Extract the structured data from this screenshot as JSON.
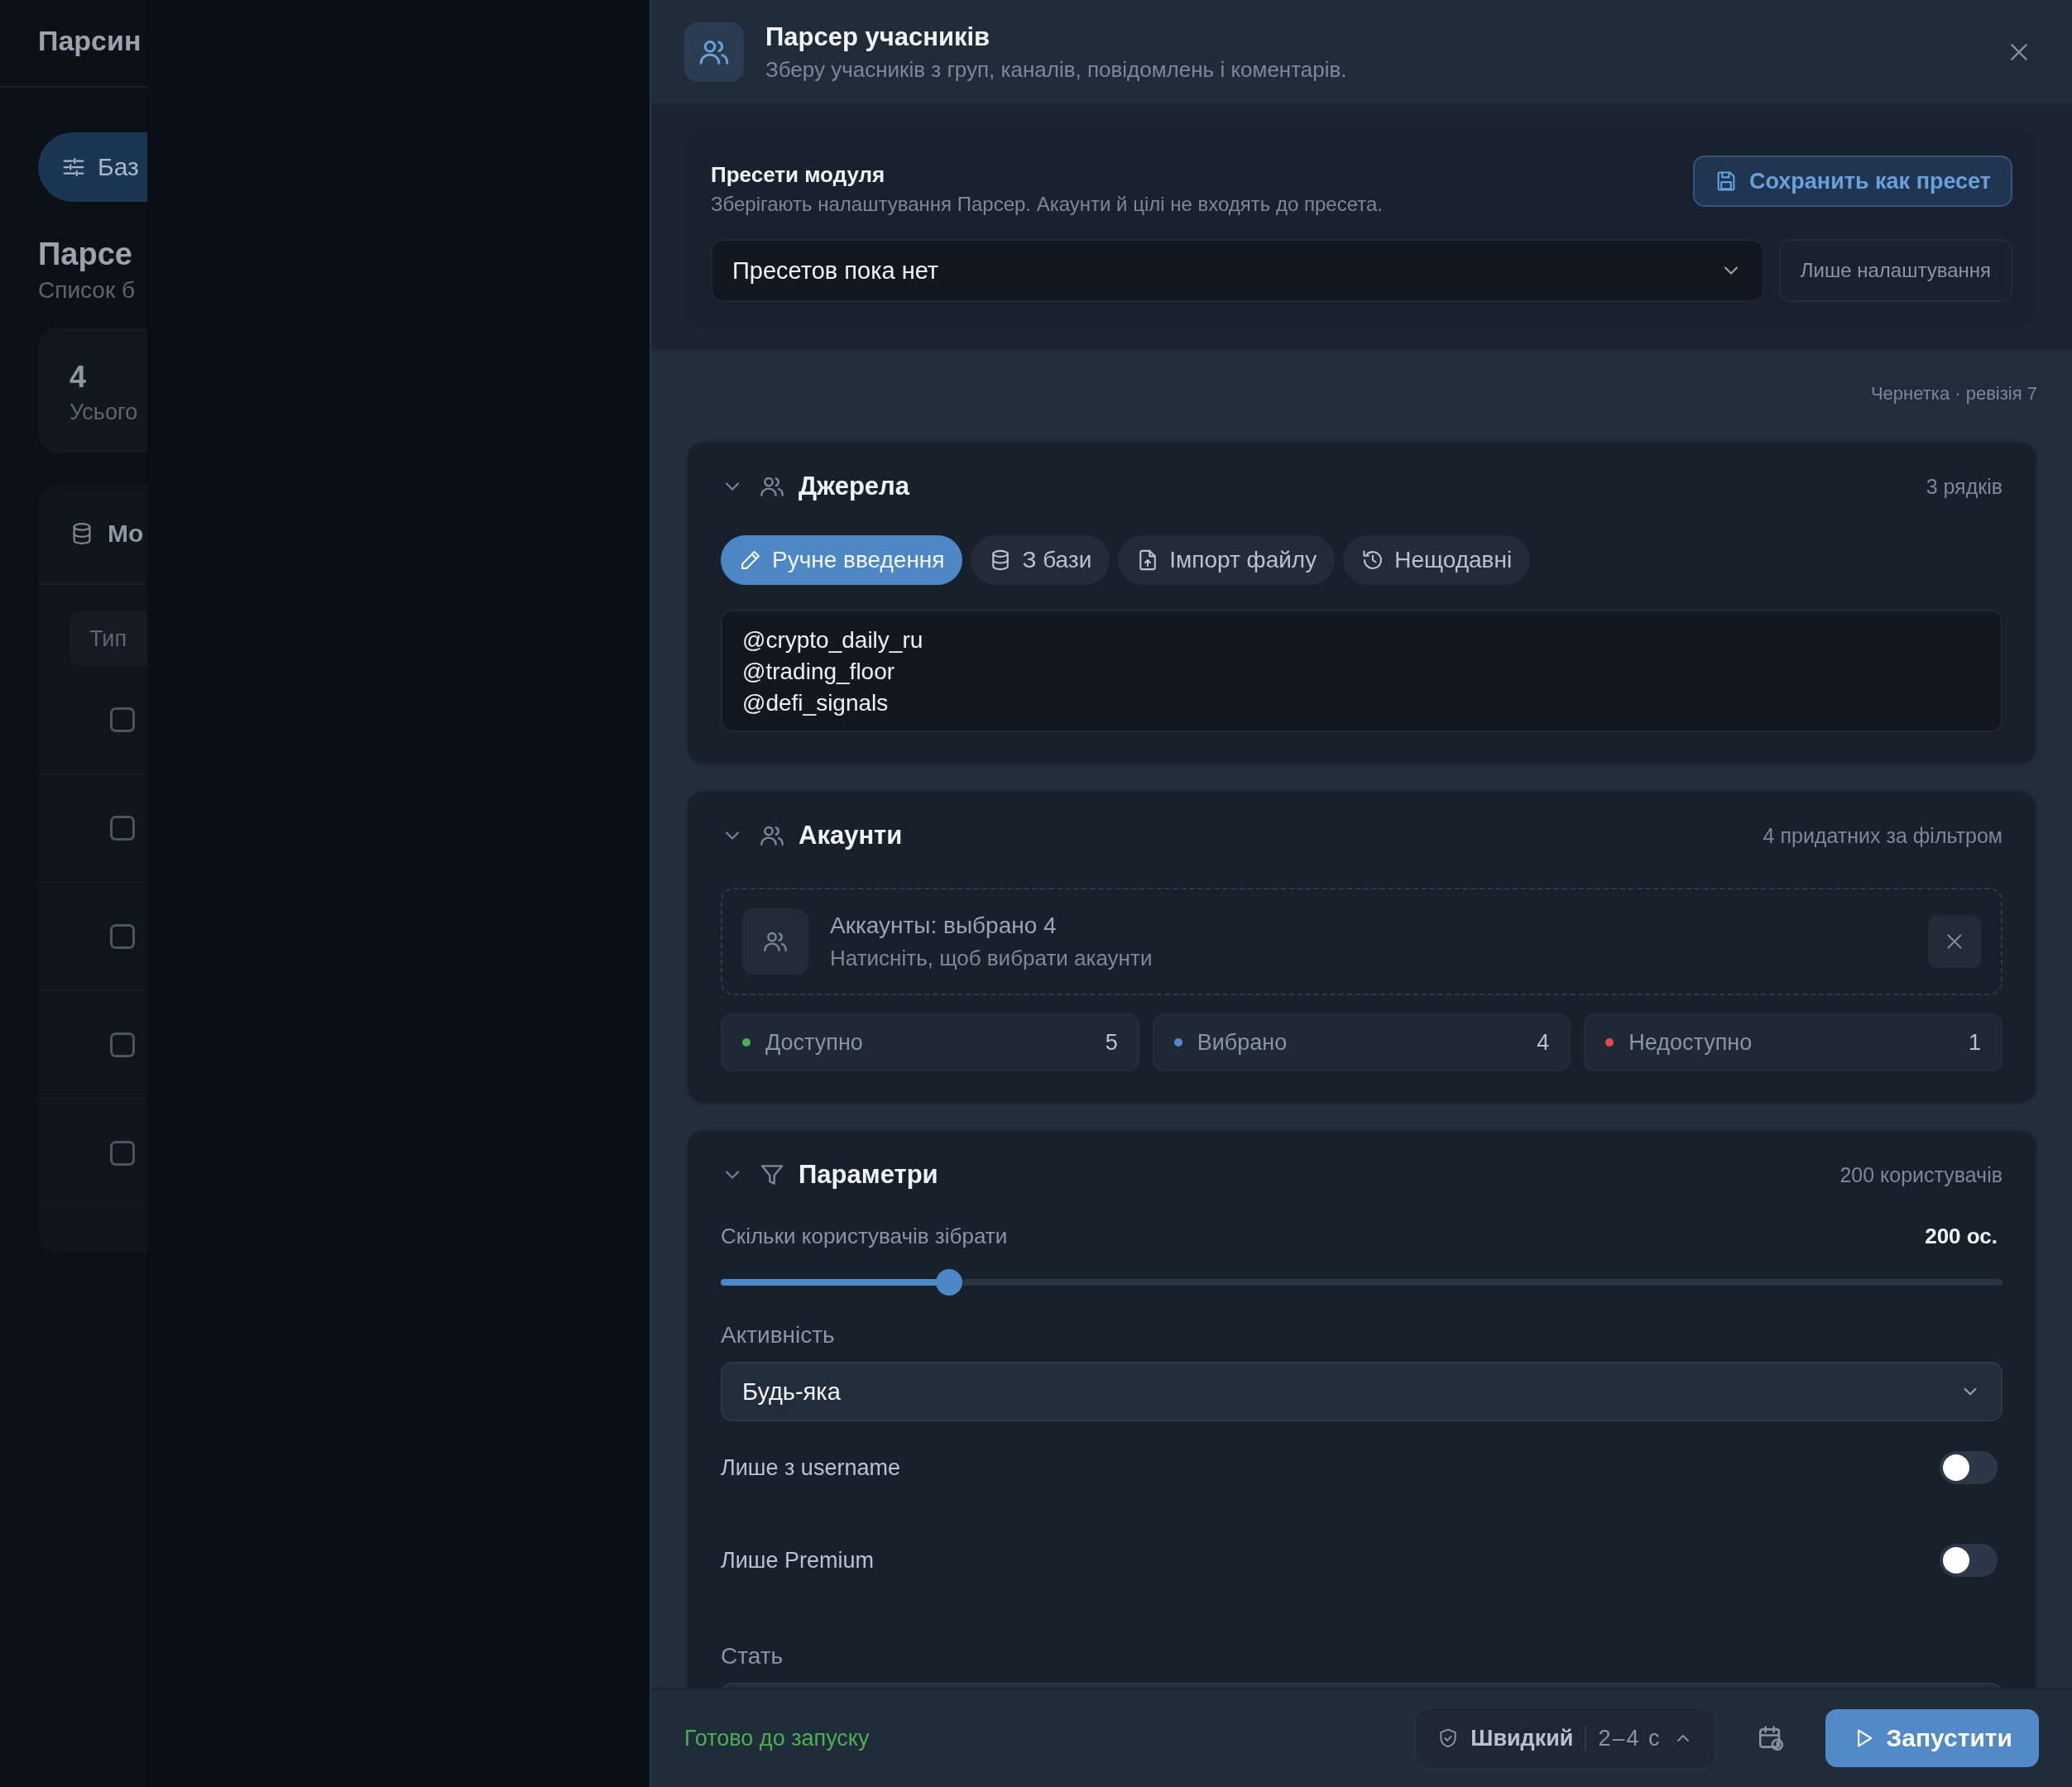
{
  "background": {
    "title": "Парсин",
    "filter_button": "Баз",
    "heading": "Парсе",
    "subheading": "Список б",
    "stat": {
      "value": "4",
      "label": "Усього"
    },
    "panel": {
      "title": "Мо",
      "filter": {
        "placeholder": "Тип"
      },
      "rows": [
        {
          "checked": false
        },
        {
          "checked": false
        },
        {
          "checked": false
        },
        {
          "checked": false
        },
        {
          "checked": false
        }
      ]
    }
  },
  "drawer": {
    "title": "Парсер учасників",
    "subtitle": "Зберу учасників з груп, каналів, повідомлень і коментарів.",
    "presets": {
      "title": "Пресети модуля",
      "description": "Зберігають налаштування Парсер. Акаунти й цілі не входять до пресета.",
      "save_button": "Сохранить как пресет",
      "select": "Пресетов пока нет",
      "settings_only_button": "Лише налаштування"
    },
    "draft_status": "Чернетка · ревізія 7",
    "sources": {
      "title": "Джерела",
      "expanded": true,
      "count": "3 рядків",
      "tabs": [
        {
          "label": "Ручне введення",
          "kind": "pencil",
          "selected": true
        },
        {
          "label": "З бази",
          "kind": "database",
          "selected": false
        },
        {
          "label": "Імпорт файлу",
          "kind": "file",
          "selected": false
        },
        {
          "label": "Нещодавні",
          "kind": "history",
          "selected": false
        }
      ],
      "text": [
        "@crypto_daily_ru",
        "@trading_floor",
        "@defi_signals"
      ]
    },
    "accounts": {
      "title": "Акаунти",
      "expanded": true,
      "count": "4 придатних за фільтром",
      "picker_title": "Аккаунты: выбрано 4",
      "picker_hint": "Натисніть, щоб вибрати акаунти",
      "stats": [
        {
          "label": "Доступно",
          "value": "5",
          "color": "#4caf50"
        },
        {
          "label": "Вибрано",
          "value": "4",
          "color": "#4d8ad0"
        },
        {
          "label": "Недоступно",
          "value": "1",
          "color": "#e5484d"
        }
      ]
    },
    "parameters": {
      "title": "Параметри",
      "expanded": true,
      "count": "200 користувачів",
      "amount_label": "Скільки користувачів зібрати",
      "amount_value": "200 ос.",
      "level": 0.178,
      "activity_label": "Активність",
      "activity_value": "Будь-яка",
      "toggles": [
        {
          "label": "Лише з username",
          "on": false
        },
        {
          "label": "Лише Premium",
          "on": false
        }
      ],
      "gender_label": "Стать"
    },
    "footer": {
      "status": "Готово до запуску",
      "mode": "Швидкий",
      "delay": "2–4 с",
      "run_button": "Запустити"
    }
  }
}
